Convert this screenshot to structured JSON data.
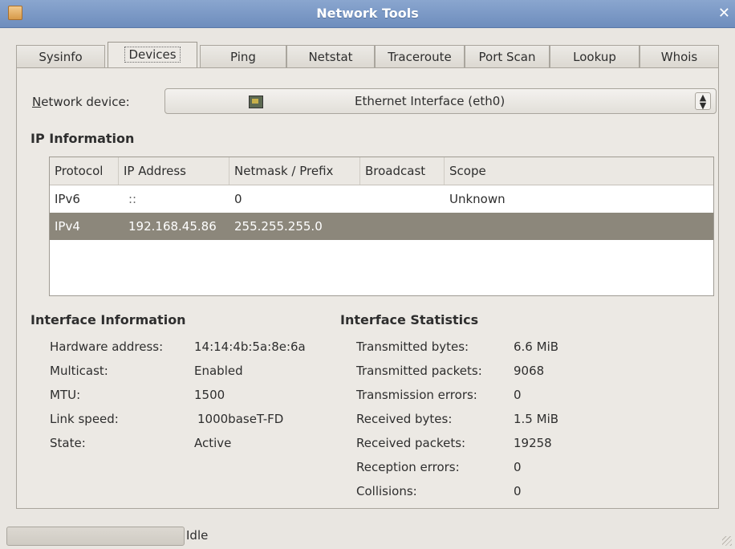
{
  "window": {
    "title": "Network Tools"
  },
  "tabs": [
    {
      "label": "Sysinfo",
      "active": false
    },
    {
      "label": "Devices",
      "active": true
    },
    {
      "label": "Ping",
      "active": false
    },
    {
      "label": "Netstat",
      "active": false
    },
    {
      "label": "Traceroute",
      "active": false
    },
    {
      "label": "Port Scan",
      "active": false
    },
    {
      "label": "Lookup",
      "active": false
    },
    {
      "label": "Whois",
      "active": false
    }
  ],
  "device": {
    "label_mnemonic": "N",
    "label_rest": "etwork device:",
    "selected": "Ethernet Interface (eth0)",
    "icon": "network-card-icon"
  },
  "ip_info": {
    "heading": "IP Information",
    "columns": [
      "Protocol",
      "IP Address",
      "Netmask / Prefix",
      "Broadcast",
      "Scope"
    ],
    "rows": [
      [
        "IPv6",
        "::",
        "0",
        "",
        "Unknown"
      ],
      [
        "IPv4",
        "192.168.45.86",
        "255.255.255.0",
        "",
        ""
      ]
    ]
  },
  "interface_info": {
    "heading": "Interface Information",
    "items": [
      {
        "key": "Hardware address:",
        "value": "14:14:4b:5a:8e:6a"
      },
      {
        "key": "Multicast:",
        "value": "Enabled"
      },
      {
        "key": "MTU:",
        "value": "1500"
      },
      {
        "key": "Link speed:",
        "value": "1000baseT-FD"
      },
      {
        "key": "State:",
        "value": "Active"
      }
    ]
  },
  "interface_stats": {
    "heading": "Interface Statistics",
    "items": [
      {
        "key": "Transmitted bytes:",
        "value": "6.6 MiB"
      },
      {
        "key": "Transmitted packets:",
        "value": "9068"
      },
      {
        "key": "Transmission errors:",
        "value": "0"
      },
      {
        "key": "Received bytes:",
        "value": "1.5 MiB"
      },
      {
        "key": "Received packets:",
        "value": "19258"
      },
      {
        "key": "Reception errors:",
        "value": "0"
      },
      {
        "key": "Collisions:",
        "value": "0"
      }
    ]
  },
  "status": {
    "text": "Idle"
  }
}
